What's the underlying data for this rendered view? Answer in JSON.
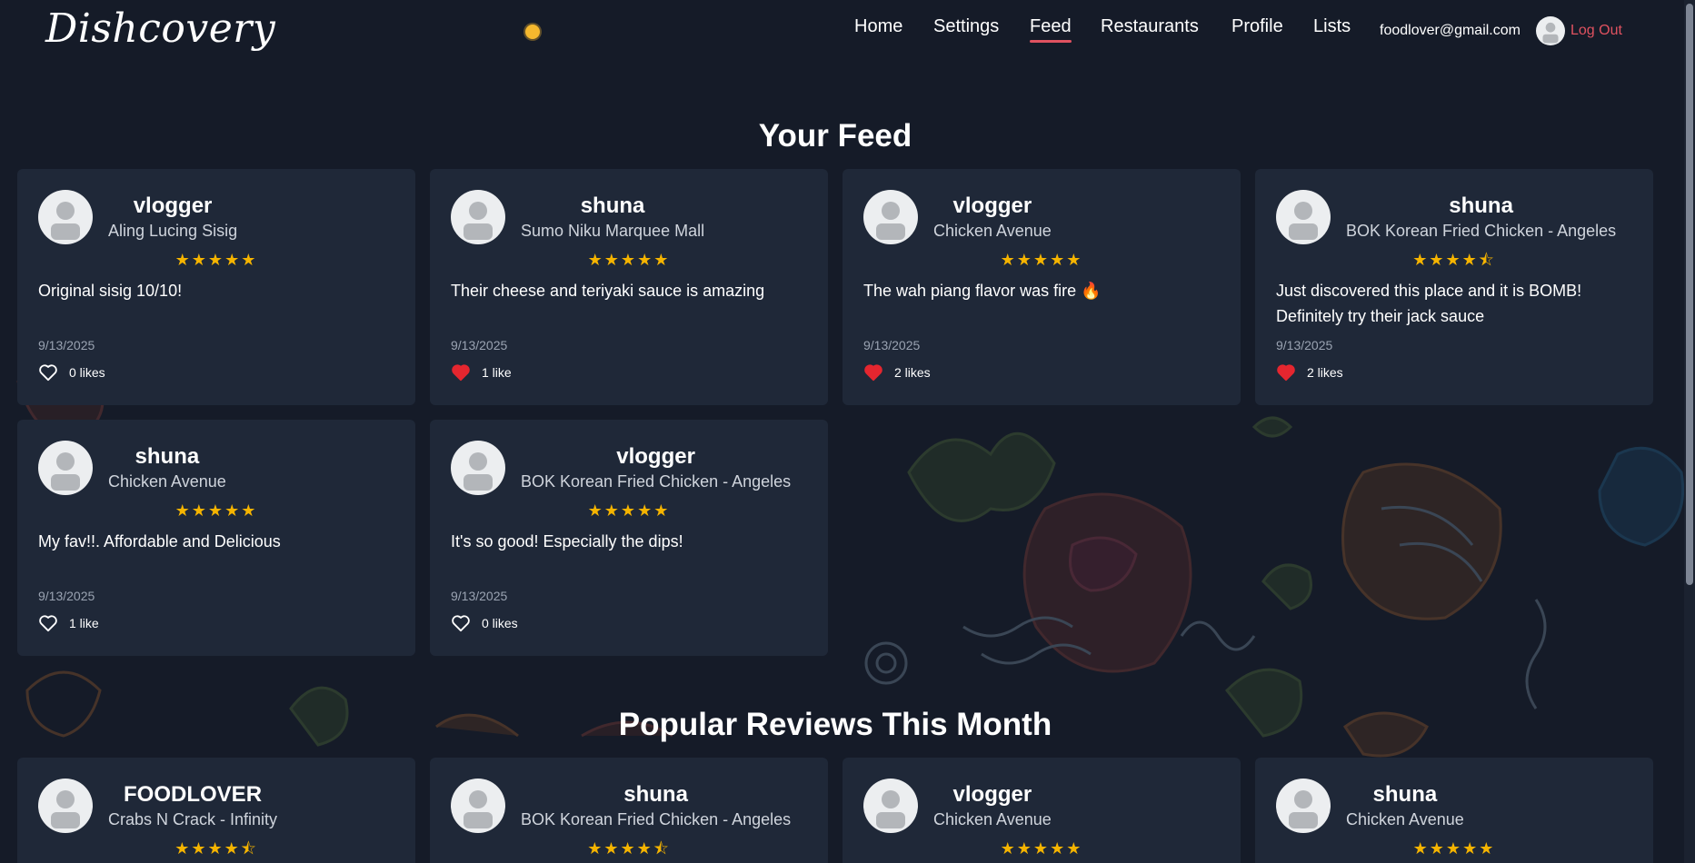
{
  "app": {
    "logo": "Dishcovery"
  },
  "nav": {
    "links": [
      "Home",
      "Settings",
      "Feed",
      "Restaurants",
      "Profile",
      "Lists"
    ],
    "active": "Feed",
    "email": "foodlover@gmail.com",
    "logout": "Log Out"
  },
  "colors": {
    "accent": "#e05260",
    "star": "#f5b400",
    "card": "#1f2838",
    "background": "#151b28"
  },
  "feed": {
    "title": "Your Feed",
    "cards": [
      {
        "user": "vlogger",
        "restaurant": "Aling Lucing Sisig",
        "rating": 5,
        "text": "Original sisig 10/10!",
        "date": "9/13/2025",
        "likes": "0 likes",
        "liked": false
      },
      {
        "user": "shuna",
        "restaurant": "Sumo Niku Marquee Mall",
        "rating": 5,
        "text": "Their cheese and teriyaki sauce is amazing",
        "date": "9/13/2025",
        "likes": "1 like",
        "liked": true
      },
      {
        "user": "vlogger",
        "restaurant": "Chicken Avenue",
        "rating": 5,
        "text": "The wah piang flavor was fire 🔥",
        "date": "9/13/2025",
        "likes": "2 likes",
        "liked": true
      },
      {
        "user": "shuna",
        "restaurant": "BOK Korean Fried Chicken - Angeles",
        "rating": 4.5,
        "text": "Just discovered this place and it is BOMB! Definitely try their jack sauce",
        "date": "9/13/2025",
        "likes": "2 likes",
        "liked": true
      },
      {
        "user": "shuna",
        "restaurant": "Chicken Avenue",
        "rating": 5,
        "text": "My fav!!. Affordable and Delicious",
        "date": "9/13/2025",
        "likes": "1 like",
        "liked": false
      },
      {
        "user": "vlogger",
        "restaurant": "BOK Korean Fried Chicken - Angeles",
        "rating": 5,
        "text": "It's so good! Especially the dips!",
        "date": "9/13/2025",
        "likes": "0 likes",
        "liked": false
      }
    ]
  },
  "popular": {
    "title": "Popular Reviews This Month",
    "cards": [
      {
        "user": "FOODLOVER",
        "restaurant": "Crabs N Crack - Infinity",
        "rating": 4.5
      },
      {
        "user": "shuna",
        "restaurant": "BOK Korean Fried Chicken - Angeles",
        "rating": 4.5
      },
      {
        "user": "vlogger",
        "restaurant": "Chicken Avenue",
        "rating": 5
      },
      {
        "user": "shuna",
        "restaurant": "Chicken Avenue",
        "rating": 5
      }
    ]
  }
}
